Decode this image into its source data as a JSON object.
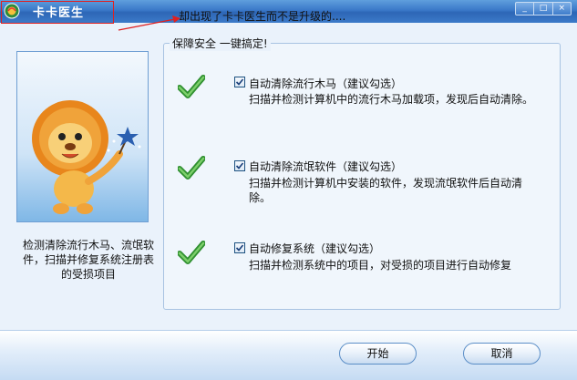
{
  "window": {
    "title": "卡卡医生",
    "controls": [
      "_",
      "□",
      "×"
    ]
  },
  "annotation": {
    "note": "却出现了卡卡医生而不是升级的...."
  },
  "sidebar": {
    "description": "检测清除流行木马、流氓软件，扫描并修复系统注册表的受损项目"
  },
  "group": {
    "legend": "保障安全 一键搞定!"
  },
  "options": [
    {
      "title": "自动清除流行木马（建议勾选）",
      "description": "扫描并检测计算机中的流行木马加载项，发现后自动清除。",
      "checked": true
    },
    {
      "title": "自动清除流氓软件（建议勾选）",
      "description": "扫描并检测计算机中安装的软件，发现流氓软件后自动清除。",
      "checked": true
    },
    {
      "title": "自动修复系统（建议勾选）",
      "description": "扫描并检测系统中的项目，对受损的项目进行自动修复",
      "checked": true
    }
  ],
  "footer": {
    "start_label": "开始",
    "cancel_label": "取消"
  },
  "colors": {
    "titlebar": "#3a78c8",
    "background": "#eaf2fb",
    "checkmark": "#3a9a3a",
    "annotation": "#e02020"
  }
}
